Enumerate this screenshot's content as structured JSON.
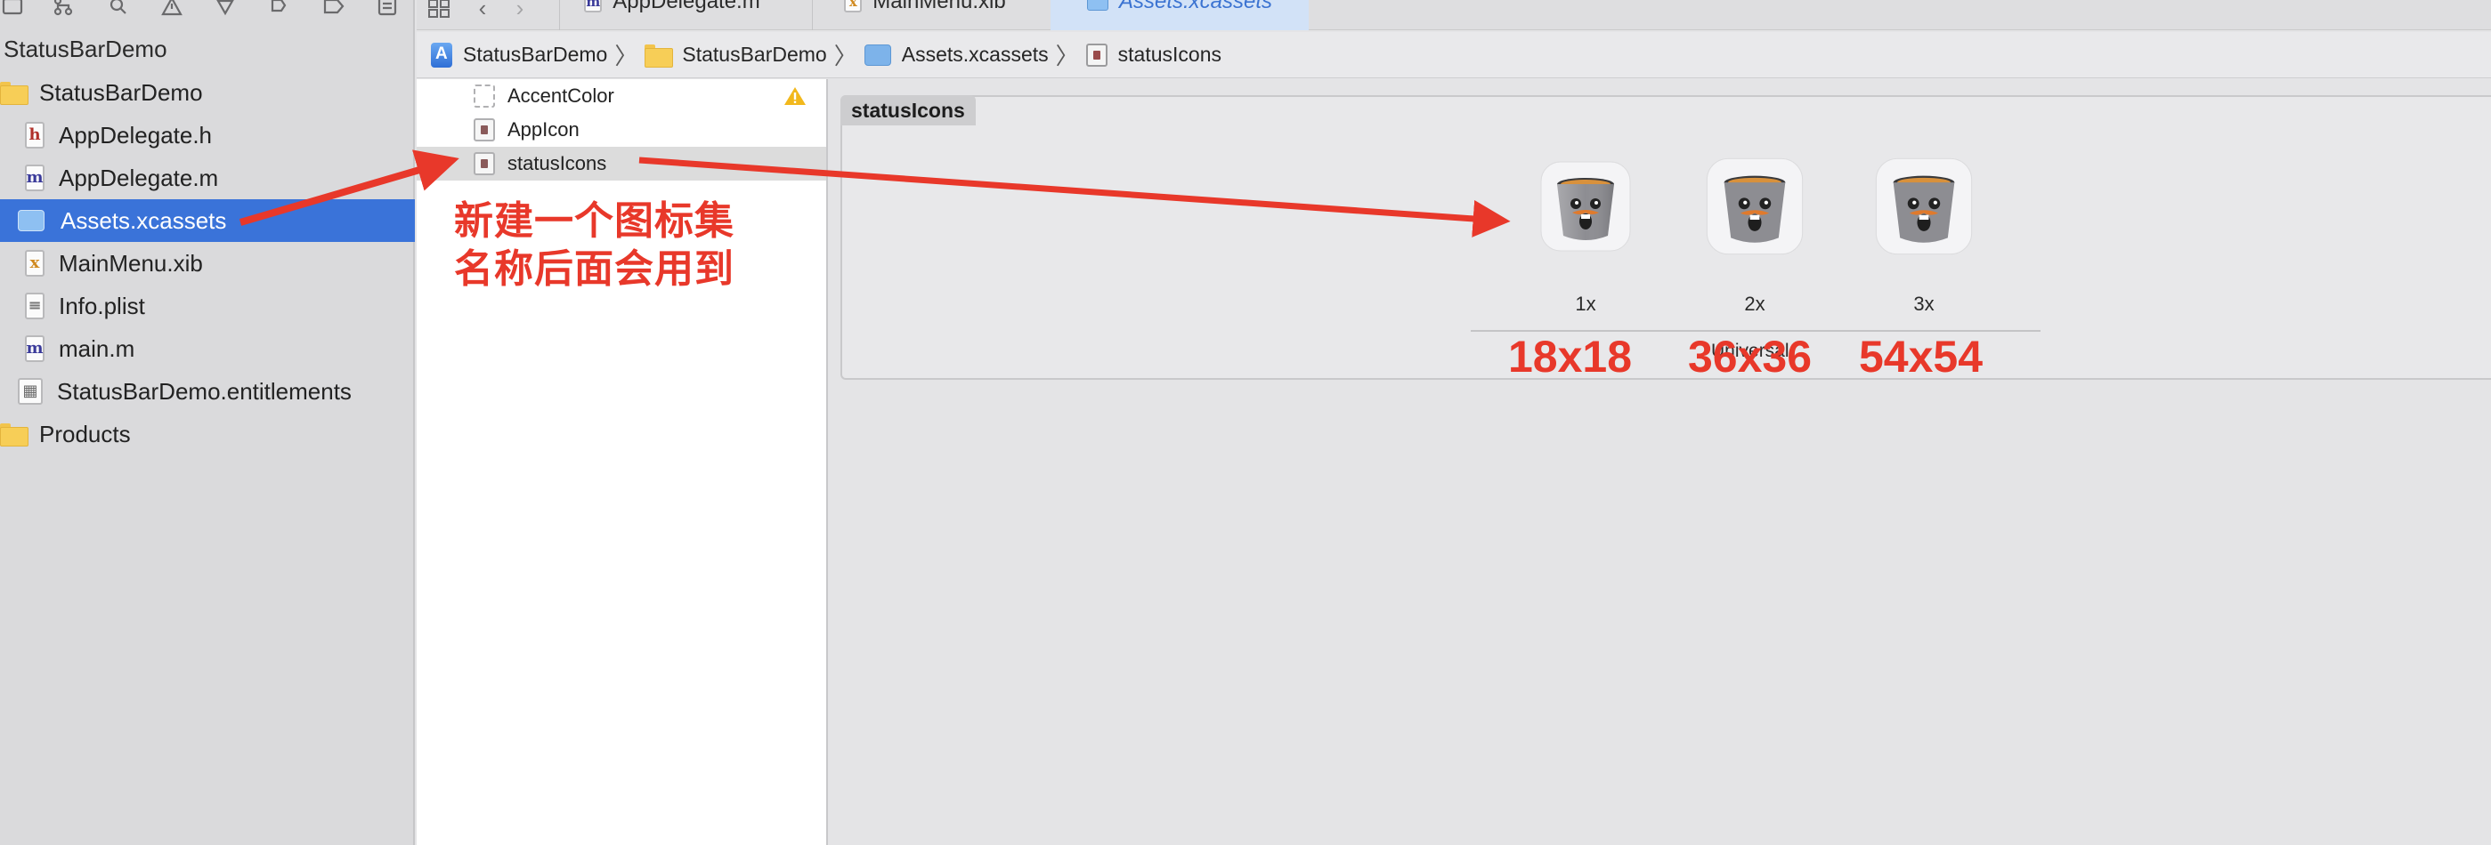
{
  "navigator": {
    "project_title": "StatusBarDemo",
    "rows": [
      {
        "label": "StatusBarDemo",
        "kind": "folder"
      },
      {
        "label": "AppDelegate.h",
        "kind": "file",
        "badge": "h",
        "badge_color": "#b0302a"
      },
      {
        "label": "AppDelegate.m",
        "kind": "file",
        "badge": "m",
        "badge_color": "#3a3a9a"
      },
      {
        "label": "Assets.xcassets",
        "kind": "assets",
        "selected": true
      },
      {
        "label": "MainMenu.xib",
        "kind": "file",
        "badge": "x",
        "badge_color": "#d08a20"
      },
      {
        "label": "Info.plist",
        "kind": "file",
        "badge": "≡",
        "badge_color": "#777777"
      },
      {
        "label": "main.m",
        "kind": "file",
        "badge": "m",
        "badge_color": "#3a3a9a"
      },
      {
        "label": "StatusBarDemo.entitlements",
        "kind": "file",
        "badge": "▦",
        "badge_color": "#6a6a6a"
      },
      {
        "label": "Products",
        "kind": "folder"
      }
    ],
    "toolbar_icons": [
      "project-navigator-icon",
      "source-control-icon",
      "search-icon",
      "issue-warning-icon",
      "test-navigator-icon",
      "debug-icon",
      "breakpoint-icon",
      "report-icon"
    ]
  },
  "editor": {
    "tabs": [
      {
        "label": "AppDelegate.m",
        "badge": "m"
      },
      {
        "label": "MainMenu.xib",
        "badge": "x"
      },
      {
        "label": "Assets.xcassets",
        "badge": "",
        "active": true
      }
    ]
  },
  "breadcrumb": [
    "StatusBarDemo",
    "StatusBarDemo",
    "Assets.xcassets",
    "statusIcons"
  ],
  "asset_list": [
    {
      "label": "AccentColor",
      "icon": "color-set-icon",
      "warning": true
    },
    {
      "label": "AppIcon",
      "icon": "app-icon-set-icon"
    },
    {
      "label": "statusIcons",
      "icon": "image-set-icon",
      "selected": true
    }
  ],
  "image_set": {
    "name": "statusIcons",
    "slots": [
      {
        "scale": "1x"
      },
      {
        "scale": "2x"
      },
      {
        "scale": "3x"
      }
    ],
    "idiom_label": "Universal"
  },
  "annotations": {
    "note_line1": "新建一个图标集",
    "note_line2": "名称后面会用到",
    "size_1x": "18x18",
    "size_2x": "36x36",
    "size_3x": "54x54",
    "color": "#e8382a"
  },
  "colors": {
    "selection": "#3a73d9",
    "sidebar_bg": "#dadadc",
    "active_tab": "#d2e2f7",
    "warning": "#f2b81c"
  }
}
